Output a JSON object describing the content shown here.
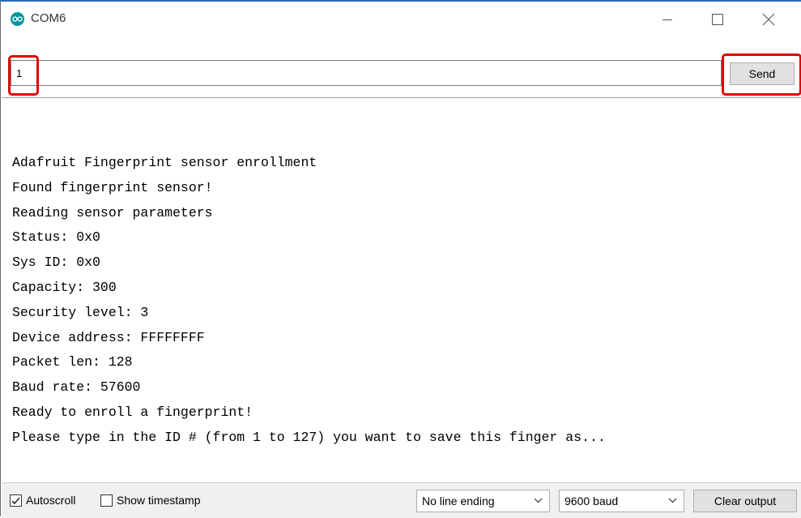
{
  "window": {
    "title": "COM6",
    "icon": "arduino-icon",
    "controls": [
      "minimize-icon",
      "maximize-icon",
      "close-icon"
    ]
  },
  "send_row": {
    "input_value": "1",
    "send_label": "Send",
    "highlight_color": "#e00000"
  },
  "output": {
    "lines": [
      "Adafruit Fingerprint sensor enrollment",
      "Found fingerprint sensor!",
      "Reading sensor parameters",
      "Status: 0x0",
      "Sys ID: 0x0",
      "Capacity: 300",
      "Security level: 3",
      "Device address: FFFFFFFF",
      "Packet len: 128",
      "Baud rate: 57600",
      "Ready to enroll a fingerprint!",
      "Please type in the ID # (from 1 to 127) you want to save this finger as..."
    ]
  },
  "bottom_bar": {
    "autoscroll_label": "Autoscroll",
    "autoscroll_checked": true,
    "timestamp_label": "Show timestamp",
    "timestamp_checked": false,
    "line_ending": "No line ending",
    "baud": "9600 baud",
    "clear_label": "Clear output"
  },
  "colors": {
    "accent_border": "#2b6cb0",
    "arduino_teal": "#00979c"
  }
}
